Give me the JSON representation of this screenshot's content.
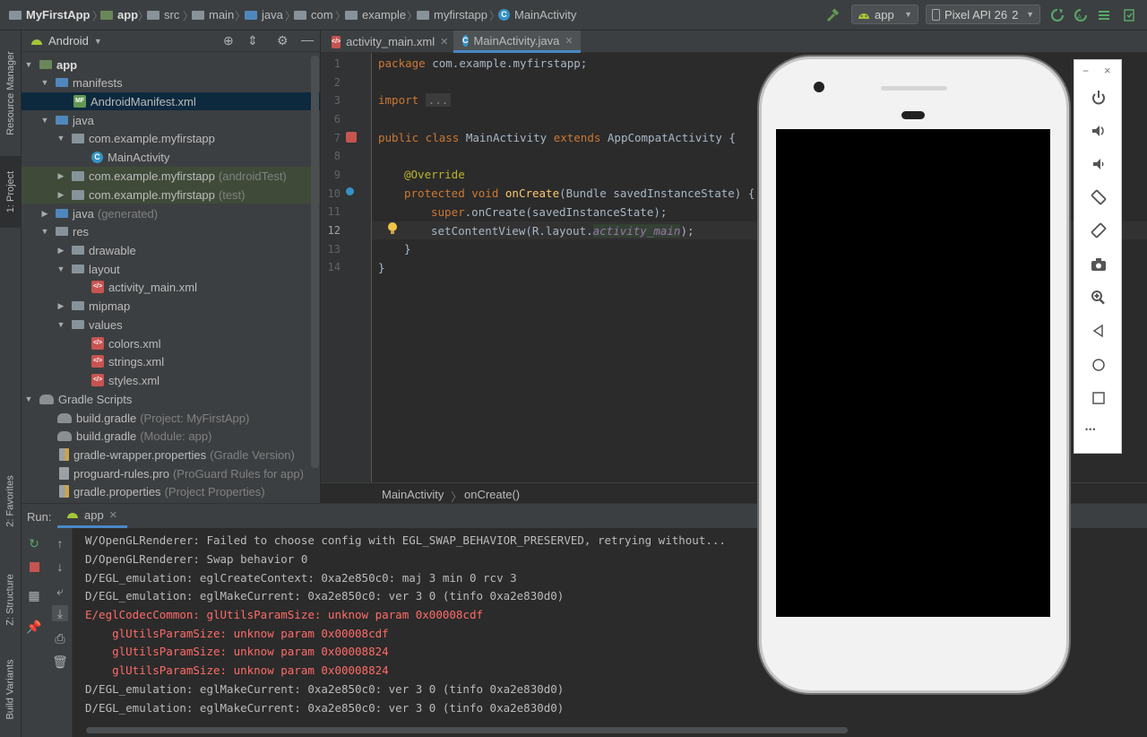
{
  "breadcrumb": [
    "MyFirstApp",
    "app",
    "src",
    "main",
    "java",
    "com",
    "example",
    "myfirstapp",
    "MainActivity"
  ],
  "toolbar": {
    "run_config": "app",
    "device": "Pixel API 26",
    "device_suffix": "2"
  },
  "side_tabs": {
    "resource_manager": "Resource Manager",
    "project": "1: Project",
    "favorites": "2: Favorites",
    "structure": "Z: Structure",
    "build_variants": "Build Variants"
  },
  "project_panel": {
    "view_mode": "Android",
    "tree": [
      {
        "label": "app",
        "extra": "",
        "icon": "folder-module-icon"
      },
      {
        "label": "manifests",
        "extra": "",
        "icon": "folder-icon"
      },
      {
        "label": "AndroidManifest.xml",
        "extra": "",
        "icon": "manifest-icon"
      },
      {
        "label": "java",
        "extra": "",
        "icon": "folder-icon"
      },
      {
        "label": "com.example.myfirstapp",
        "extra": "",
        "icon": "package-icon"
      },
      {
        "label": "MainActivity",
        "extra": "",
        "icon": "class-icon"
      },
      {
        "label": "com.example.myfirstapp",
        "extra": "(androidTest)",
        "icon": "package-icon"
      },
      {
        "label": "com.example.myfirstapp",
        "extra": "(test)",
        "icon": "package-icon"
      },
      {
        "label": "java",
        "extra": "(generated)",
        "icon": "folder-icon"
      },
      {
        "label": "res",
        "extra": "",
        "icon": "folder-icon"
      },
      {
        "label": "drawable",
        "extra": "",
        "icon": "folder-icon"
      },
      {
        "label": "layout",
        "extra": "",
        "icon": "folder-icon"
      },
      {
        "label": "activity_main.xml",
        "extra": "",
        "icon": "xml-icon"
      },
      {
        "label": "mipmap",
        "extra": "",
        "icon": "folder-icon"
      },
      {
        "label": "values",
        "extra": "",
        "icon": "folder-icon"
      },
      {
        "label": "colors.xml",
        "extra": "",
        "icon": "xml-icon"
      },
      {
        "label": "strings.xml",
        "extra": "",
        "icon": "xml-icon"
      },
      {
        "label": "styles.xml",
        "extra": "",
        "icon": "xml-icon"
      },
      {
        "label": "Gradle Scripts",
        "extra": "",
        "icon": "gradle-icon"
      },
      {
        "label": "build.gradle",
        "extra": "(Project: MyFirstApp)",
        "icon": "gradle-icon"
      },
      {
        "label": "build.gradle",
        "extra": "(Module: app)",
        "icon": "gradle-icon"
      },
      {
        "label": "gradle-wrapper.properties",
        "extra": "(Gradle Version)",
        "icon": "properties-icon"
      },
      {
        "label": "proguard-rules.pro",
        "extra": "(ProGuard Rules for app)",
        "icon": "file-icon"
      },
      {
        "label": "gradle.properties",
        "extra": "(Project Properties)",
        "icon": "properties-icon"
      }
    ]
  },
  "editor_tabs": [
    "activity_main.xml",
    "MainActivity.java"
  ],
  "code": {
    "line_numbers": [
      "1",
      "2",
      "3",
      "6",
      "7",
      "8",
      "9",
      "10",
      "11",
      "12",
      "13",
      "14"
    ],
    "package_kw": "package",
    "package_name": "com.example.myfirstapp;",
    "import_kw": "import",
    "import_fold": "...",
    "class_line_kw": "public class",
    "class_name": "MainActivity",
    "extends_kw": "extends",
    "super_class": "AppCompatActivity {",
    "annotation": "@Override",
    "method_kw": "protected void",
    "method_name": "onCreate",
    "method_params": "(Bundle savedInstanceState) {",
    "super_kw": "super",
    "super_call": ".onCreate(savedInstanceState);",
    "set_content": "setContentView(R.layout.",
    "set_content_field": "activity_main",
    "set_content_end": ");",
    "close_method": "}",
    "close_class": "}"
  },
  "editor_breadcrumb": [
    "MainActivity",
    "onCreate()"
  ],
  "run_panel": {
    "label": "Run:",
    "tab": "app",
    "lines": [
      {
        "text": "W/OpenGLRenderer: Failed to choose config with EGL_SWAP_BEHAVIOR_PRESERVED, retrying without...",
        "level": "n"
      },
      {
        "text": "D/OpenGLRenderer: Swap behavior 0",
        "level": "n"
      },
      {
        "text": "D/EGL_emulation: eglCreateContext: 0xa2e850c0: maj 3 min 0 rcv 3",
        "level": "n"
      },
      {
        "text": "D/EGL_emulation: eglMakeCurrent: 0xa2e850c0: ver 3 0 (tinfo 0xa2e830d0)",
        "level": "n"
      },
      {
        "text": "E/eglCodecCommon: glUtilsParamSize: unknow param 0x00008cdf",
        "level": "e"
      },
      {
        "text": "    glUtilsParamSize: unknow param 0x00008cdf",
        "level": "e"
      },
      {
        "text": "    glUtilsParamSize: unknow param 0x00008824",
        "level": "e"
      },
      {
        "text": "    glUtilsParamSize: unknow param 0x00008824",
        "level": "e"
      },
      {
        "text": "D/EGL_emulation: eglMakeCurrent: 0xa2e850c0: ver 3 0 (tinfo 0xa2e830d0)",
        "level": "n"
      },
      {
        "text": "D/EGL_emulation: eglMakeCurrent: 0xa2e850c0: ver 3 0 (tinfo 0xa2e830d0)",
        "level": "n"
      }
    ]
  },
  "emulator": {
    "minimize": "−",
    "close": "×",
    "more": "•••"
  },
  "colors": {
    "accent": "#4a88c7",
    "error_text": "#ff6b68",
    "android_green": "#a4c639"
  }
}
